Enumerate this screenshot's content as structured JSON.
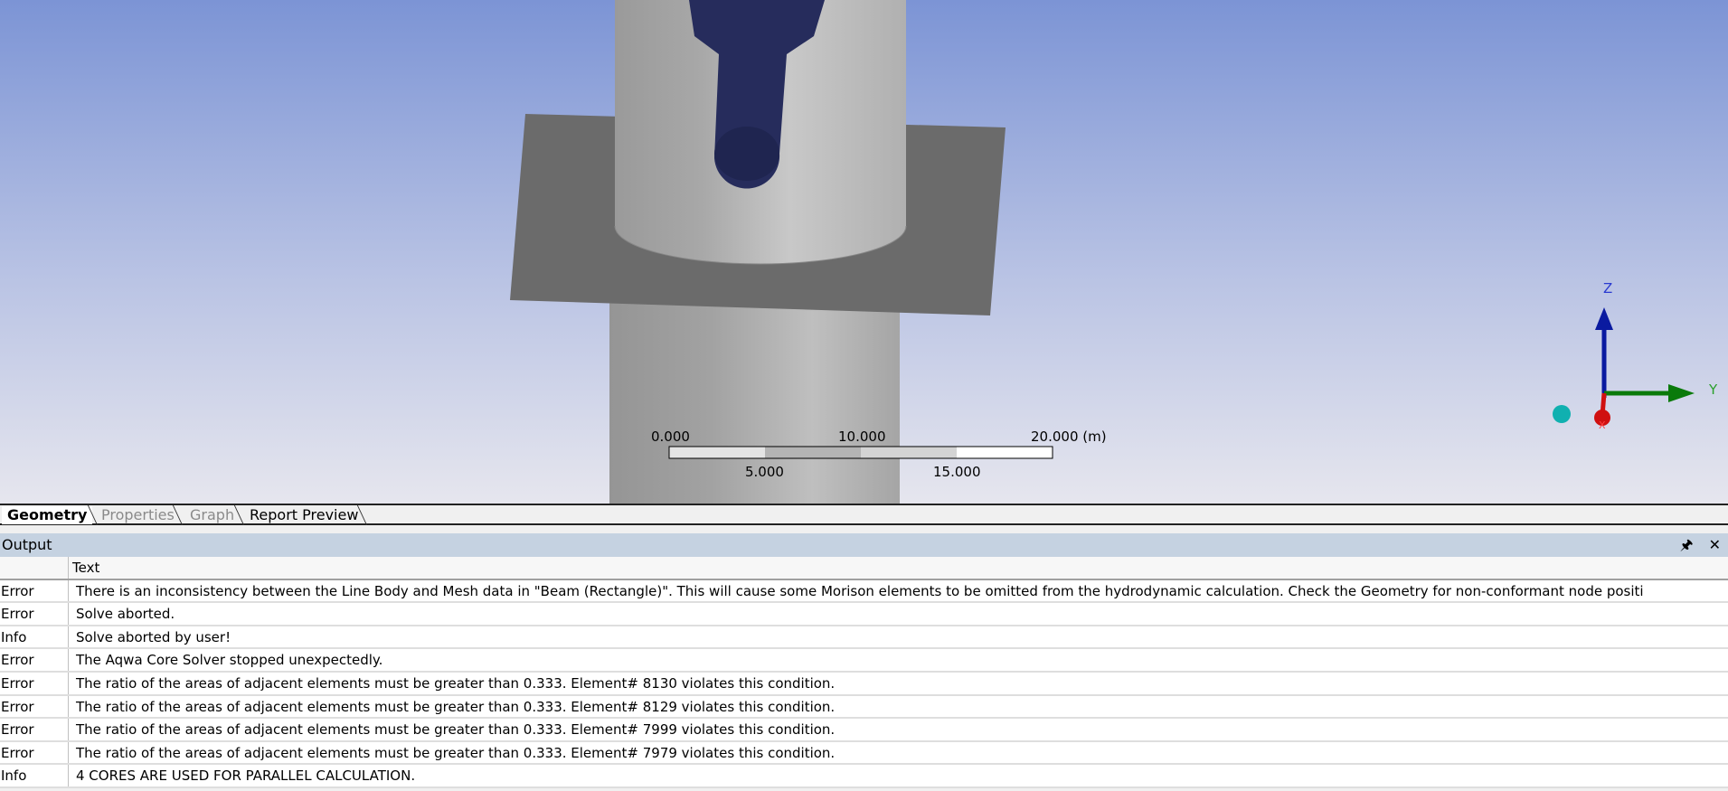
{
  "viewport": {
    "scale_bar": {
      "top_labels": [
        "0.000",
        "10.000",
        "20.000 (m)"
      ],
      "bottom_labels": [
        "5.000",
        "15.000"
      ]
    },
    "triad": {
      "z_label": "Z",
      "y_label": "Y",
      "x_label": "X",
      "colors": {
        "z": "#0a1aa0",
        "y": "#0a7a0a",
        "x": "#d01010",
        "iso": "#10b0b0"
      }
    }
  },
  "tabs": [
    {
      "label": "Geometry",
      "active": true
    },
    {
      "label": "Properties",
      "active": false
    },
    {
      "label": "Graph",
      "active": false
    },
    {
      "label": "Report Preview",
      "active": false
    }
  ],
  "output": {
    "title": "Output",
    "pin_icon": "pin-icon",
    "close_icon": "close-icon",
    "columns": [
      "",
      "Text"
    ],
    "rows": [
      {
        "type": "Error",
        "text": "There is an inconsistency between the Line Body and Mesh data in \"Beam (Rectangle)\". This will cause some Morison elements to be omitted from the hydrodynamic calculation. Check the Geometry for non-conformant node positi"
      },
      {
        "type": "Error",
        "text": "Solve aborted."
      },
      {
        "type": "Info",
        "text": "Solve aborted by user!"
      },
      {
        "type": "Error",
        "text": "The Aqwa Core Solver stopped unexpectedly."
      },
      {
        "type": "Error",
        "text": "The ratio of the areas of adjacent elements must be greater than 0.333. Element# 8130 violates this condition."
      },
      {
        "type": "Error",
        "text": "The ratio of the areas of adjacent elements must be greater than 0.333. Element# 8129 violates this condition."
      },
      {
        "type": "Error",
        "text": "The ratio of the areas of adjacent elements must be greater than 0.333. Element# 7999 violates this condition."
      },
      {
        "type": "Error",
        "text": "The ratio of the areas of adjacent elements must be greater than 0.333. Element# 7979 violates this condition."
      },
      {
        "type": "Info",
        "text": "4 CORES ARE USED FOR PARALLEL CALCULATION."
      }
    ]
  }
}
